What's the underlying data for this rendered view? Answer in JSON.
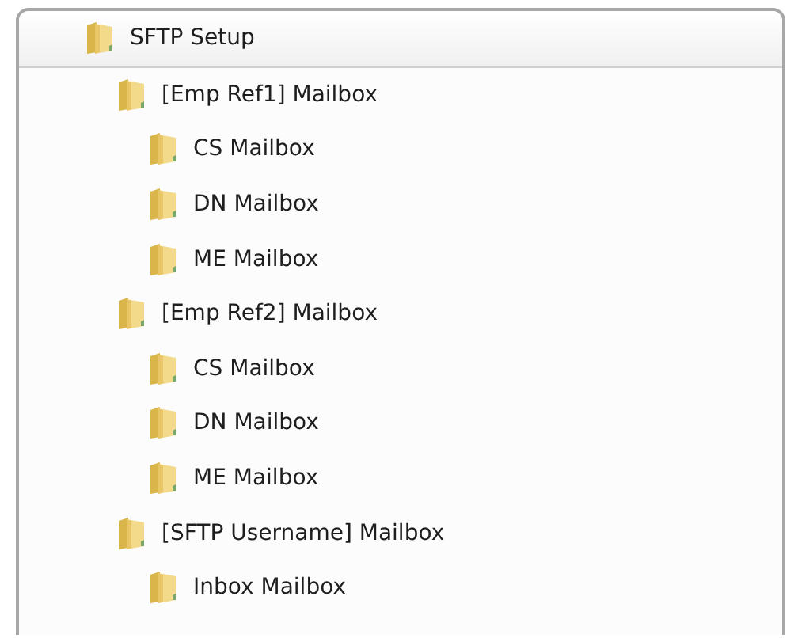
{
  "tree": {
    "label": "SFTP Setup",
    "children": [
      {
        "label": "[Emp Ref1] Mailbox",
        "children": [
          {
            "label": "CS Mailbox"
          },
          {
            "label": "DN Mailbox"
          },
          {
            "label": "ME Mailbox"
          }
        ]
      },
      {
        "label": "[Emp Ref2] Mailbox",
        "children": [
          {
            "label": "CS Mailbox"
          },
          {
            "label": "DN Mailbox"
          },
          {
            "label": "ME Mailbox"
          }
        ]
      },
      {
        "label": "[SFTP Username] Mailbox",
        "children": [
          {
            "label": "Inbox Mailbox"
          }
        ]
      }
    ]
  }
}
